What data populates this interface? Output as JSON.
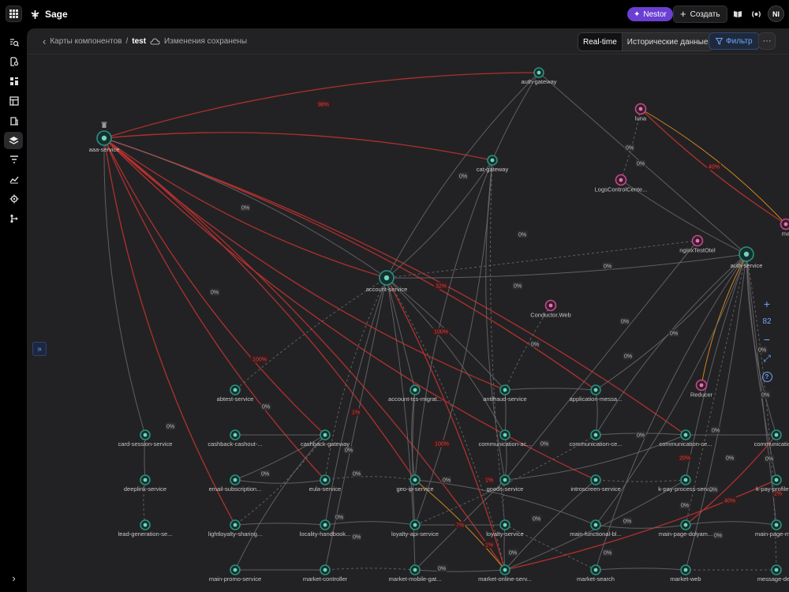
{
  "app": {
    "name": "Sage",
    "nestor_label": "Nestor",
    "create_label": "Создать",
    "avatar_initials": "NI"
  },
  "sidebar": {
    "items": [
      {
        "icon": "search-list-icon"
      },
      {
        "icon": "file-search-icon"
      },
      {
        "icon": "dashboard-icon"
      },
      {
        "icon": "table-icon"
      },
      {
        "icon": "building-icon"
      },
      {
        "icon": "component-map-icon"
      },
      {
        "icon": "filter-lines-icon"
      },
      {
        "icon": "trend-chart-icon"
      },
      {
        "icon": "gear-alert-icon"
      },
      {
        "icon": "flow-icon"
      }
    ]
  },
  "header": {
    "breadcrumb_parent": "Карты компонентов",
    "separator": "/",
    "breadcrumb_current": "test",
    "save_status": "Изменения сохранены",
    "realtime_label": "Real-time",
    "historical_label": "Исторические данные",
    "filter_label": "Фильтр",
    "more_label": "···"
  },
  "zoom": {
    "plus": "+",
    "level": "82",
    "minus": "−",
    "fit": "⤢",
    "help": "?"
  },
  "colors": {
    "node_teal": "#2a8f7e",
    "node_pink": "#c24a8a",
    "edge_red": "#b8312f",
    "edge_orange": "#d98a1e",
    "accent_blue": "#6fa5ff",
    "brand_purple": "#6a3fd1"
  },
  "graph": {
    "nodes": [
      {
        "label": "aaa-service",
        "kind": "teal"
      },
      {
        "label": "auth-gateway",
        "kind": "teal"
      },
      {
        "label": "luna",
        "kind": "pink"
      },
      {
        "label": "cat-gateway",
        "kind": "teal"
      },
      {
        "label": "LogsControlCente...",
        "kind": "pink"
      },
      {
        "label": "ma",
        "kind": "pink"
      },
      {
        "label": "nginxTestOtel",
        "kind": "pink"
      },
      {
        "label": "auth-service",
        "kind": "teal"
      },
      {
        "label": "account-service",
        "kind": "teal"
      },
      {
        "label": "Conductor.Web",
        "kind": "pink"
      },
      {
        "label": "Reducer",
        "kind": "pink"
      },
      {
        "label": "abtest-service",
        "kind": "teal"
      },
      {
        "label": "account-tcs-migrat...",
        "kind": "teal"
      },
      {
        "label": "antifraud-service",
        "kind": "teal"
      },
      {
        "label": "application-messa...",
        "kind": "teal"
      },
      {
        "label": "card-session-service",
        "kind": "teal"
      },
      {
        "label": "cashback-cashout-...",
        "kind": "teal"
      },
      {
        "label": "cashback-gateway",
        "kind": "teal"
      },
      {
        "label": "communication-ac...",
        "kind": "teal"
      },
      {
        "label": "communication-ce...",
        "kind": "teal"
      },
      {
        "label": "communication-ce...",
        "kind": "teal"
      },
      {
        "label": "communication...",
        "kind": "teal"
      },
      {
        "label": "deeplink-service",
        "kind": "teal"
      },
      {
        "label": "email-subscription...",
        "kind": "teal"
      },
      {
        "label": "eula-service",
        "kind": "teal"
      },
      {
        "label": "geo-ip-service",
        "kind": "teal"
      },
      {
        "label": "goods-service",
        "kind": "teal"
      },
      {
        "label": "introscreen-service",
        "kind": "teal"
      },
      {
        "label": "k-pay-process-serv...",
        "kind": "teal"
      },
      {
        "label": "k-pay-profile-se",
        "kind": "teal"
      },
      {
        "label": "lead-generation-se...",
        "kind": "teal"
      },
      {
        "label": "lightloyalty-sharing...",
        "kind": "teal"
      },
      {
        "label": "locality-handbook...",
        "kind": "teal"
      },
      {
        "label": "loyalty-api-service",
        "kind": "teal"
      },
      {
        "label": "loyalty-service",
        "kind": "teal"
      },
      {
        "label": "main-functional-bl...",
        "kind": "teal"
      },
      {
        "label": "main-page-dolyam...",
        "kind": "teal"
      },
      {
        "label": "main-page-mobi",
        "kind": "teal"
      },
      {
        "label": "main-promo-service",
        "kind": "teal"
      },
      {
        "label": "market-controller",
        "kind": "teal"
      },
      {
        "label": "market-mobile-gat...",
        "kind": "teal"
      },
      {
        "label": "market-online-serv...",
        "kind": "teal"
      },
      {
        "label": "market-search",
        "kind": "teal"
      },
      {
        "label": "market-web",
        "kind": "teal"
      },
      {
        "label": "message-deliv",
        "kind": "teal"
      }
    ],
    "edge_labels": [
      "98%",
      "0%",
      "0%",
      "0%",
      "40%",
      "0%",
      "0%",
      "0%",
      "0%",
      "0%",
      "32%",
      "0%",
      "0%",
      "100%",
      "0%",
      "0%",
      "100%",
      "0%",
      "0%",
      "0%",
      "0%",
      "1%",
      "0%",
      "0%",
      "0%",
      "100%",
      "0%",
      "20%",
      "0%",
      "0%",
      "0%",
      "1%",
      "0%",
      "0%",
      "0%",
      "0%",
      "7%",
      "0%",
      "0%",
      "0%",
      "2%",
      "0%",
      "40%",
      "0%",
      "1%",
      "0%",
      "0%",
      "0%"
    ]
  }
}
